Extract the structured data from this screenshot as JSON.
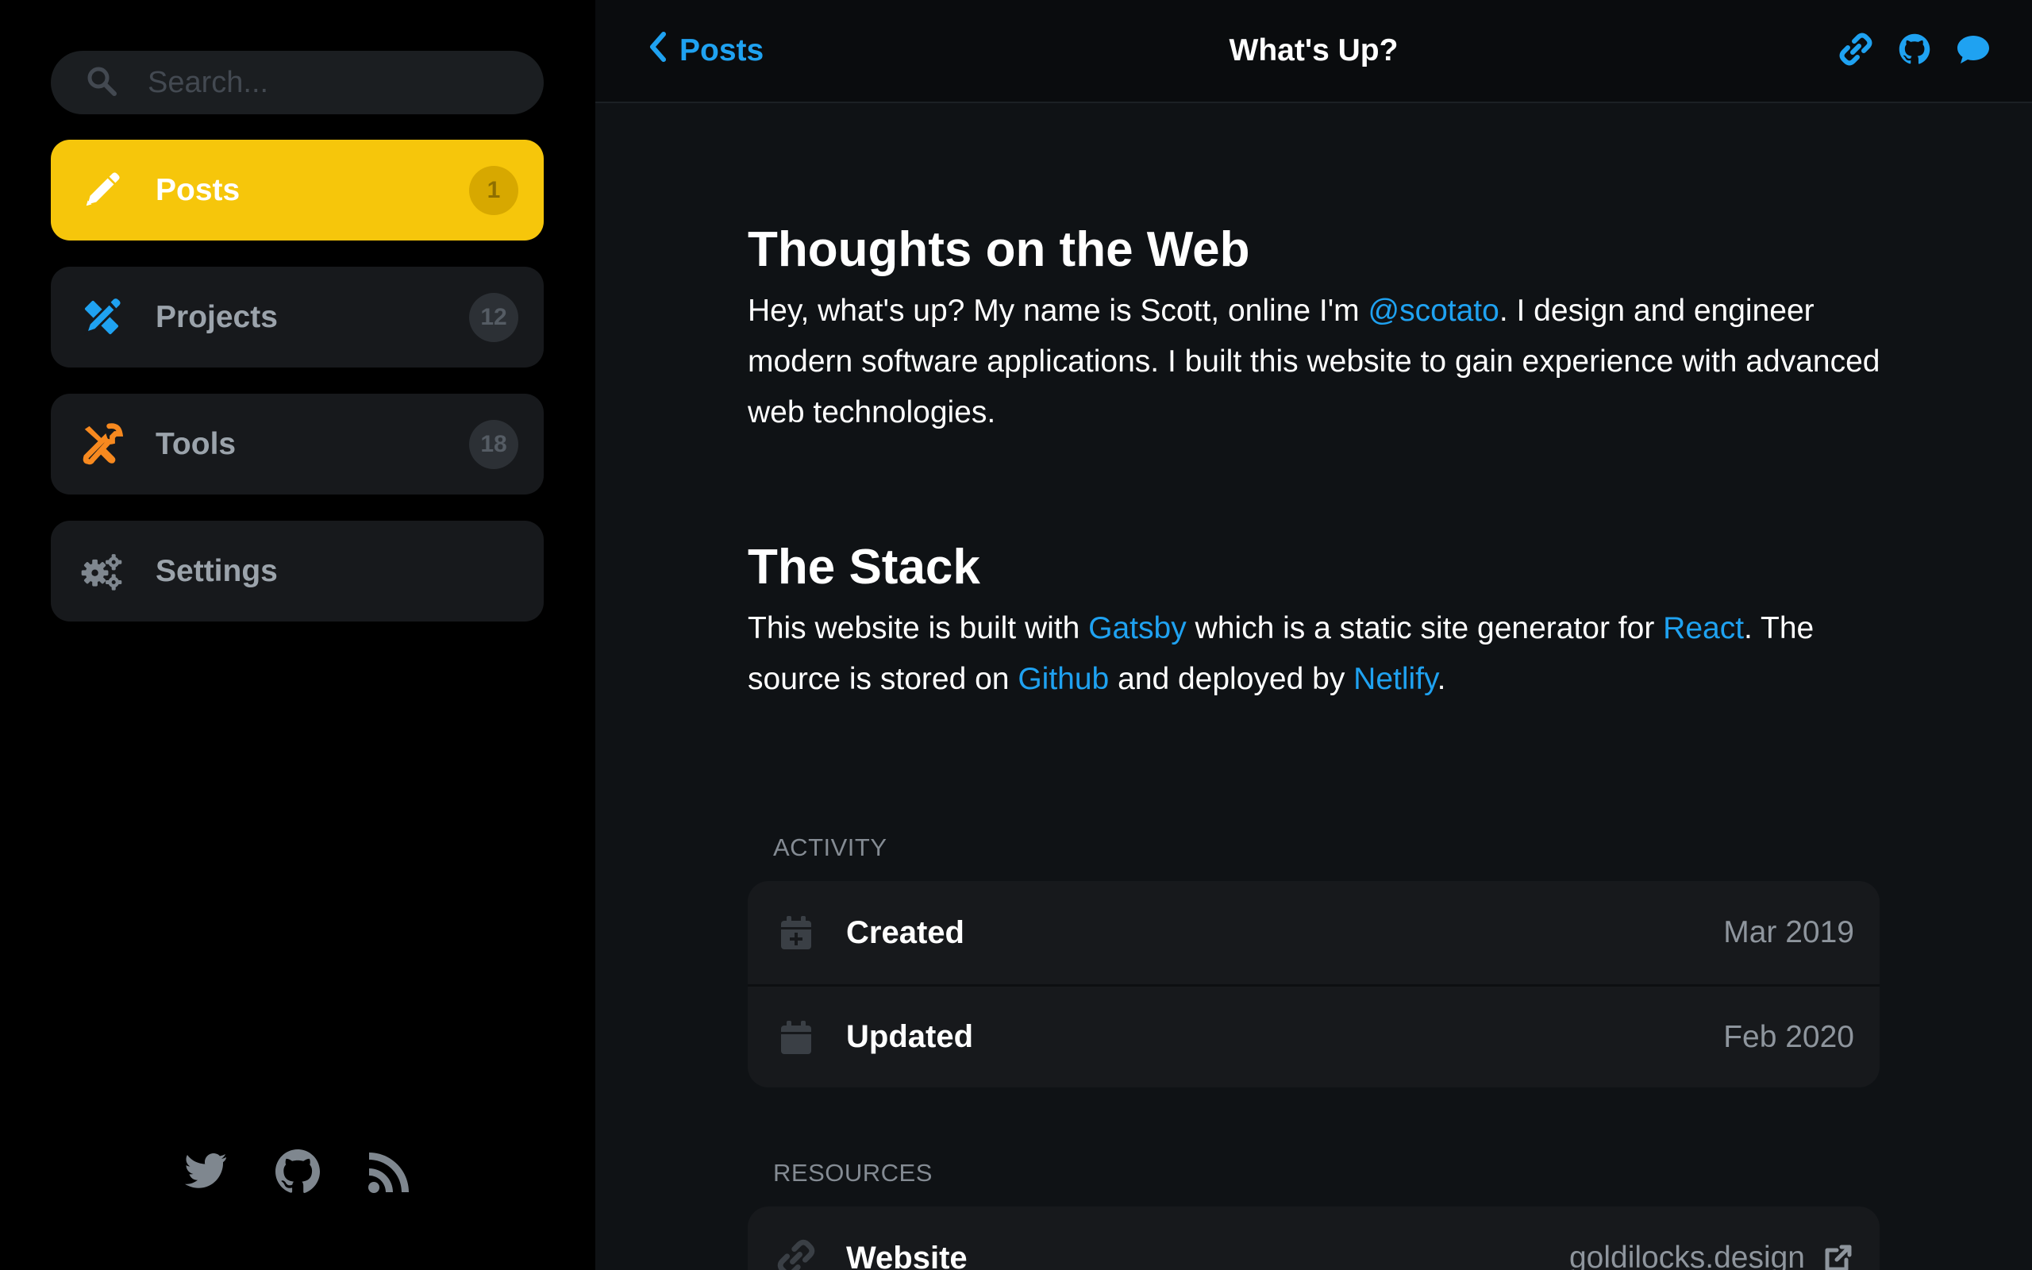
{
  "sidebar": {
    "search": {
      "placeholder": "Search..."
    },
    "nav": [
      {
        "label": "Posts",
        "count": "1",
        "icon": "pencil-icon",
        "color": "#f6c60b",
        "active": true
      },
      {
        "label": "Projects",
        "count": "12",
        "icon": "pencil-ruler-icon",
        "color": "#1fa2f1",
        "active": false
      },
      {
        "label": "Tools",
        "count": "18",
        "icon": "tools-icon",
        "color": "#f7891f",
        "active": false
      },
      {
        "label": "Settings",
        "count": "",
        "icon": "gears-icon",
        "color": "#7f878f",
        "active": false
      }
    ],
    "social": [
      "twitter-icon",
      "github-icon",
      "rss-icon"
    ]
  },
  "topbar": {
    "back_label": "Posts",
    "title": "What's Up?",
    "actions": [
      "link-icon",
      "github-icon",
      "comment-icon"
    ]
  },
  "article": {
    "section1": {
      "title": "Thoughts on the Web",
      "text_a": "Hey, what's up? My name is Scott, online I'm ",
      "link_a": "@scotato",
      "text_b": ". I design and engineer modern software applications. I built this website to gain experience with advanced web technologies."
    },
    "section2": {
      "title": "The Stack",
      "text_a": "This website is built with ",
      "link_a": "Gatsby",
      "text_b": " which is a static site generator for ",
      "link_b": "React",
      "text_c": ". The source is stored on ",
      "link_c": "Github",
      "text_d": " and deployed by ",
      "link_d": "Netlify",
      "text_e": "."
    }
  },
  "activity": {
    "label": "ACTIVITY",
    "rows": [
      {
        "label": "Created",
        "value": "Mar 2019",
        "icon": "calendar-plus-icon"
      },
      {
        "label": "Updated",
        "value": "Feb 2020",
        "icon": "calendar-icon"
      }
    ]
  },
  "resources": {
    "label": "RESOURCES",
    "rows": [
      {
        "label": "Website",
        "value": "goldilocks.design",
        "icon": "link-icon",
        "action_icon": "external-link-icon"
      }
    ]
  },
  "colors": {
    "accent_blue": "#1fa2f1",
    "posts_yellow": "#f6c60b",
    "tools_orange": "#f7891f",
    "sidebar_bg": "#000000",
    "main_bg": "#0f1215",
    "panel_bg": "#17191c"
  }
}
